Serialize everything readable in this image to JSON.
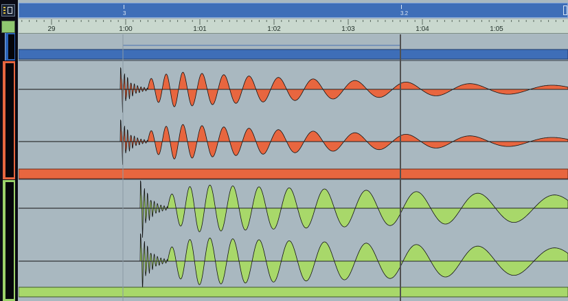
{
  "markers": {
    "left_label": "3",
    "right_label": "3.2"
  },
  "ruler": {
    "labels": [
      "29",
      "1:00",
      "1:01",
      "1:02",
      "1:03",
      "1:04",
      "1:05"
    ]
  },
  "colors": {
    "blue_track": "#3e6eb8",
    "audio_track_1": "#e8663f",
    "audio_track_2": "#a8d86a",
    "background": "#a9b8c0"
  },
  "icons": {
    "window_button": "window-restore-icon"
  }
}
